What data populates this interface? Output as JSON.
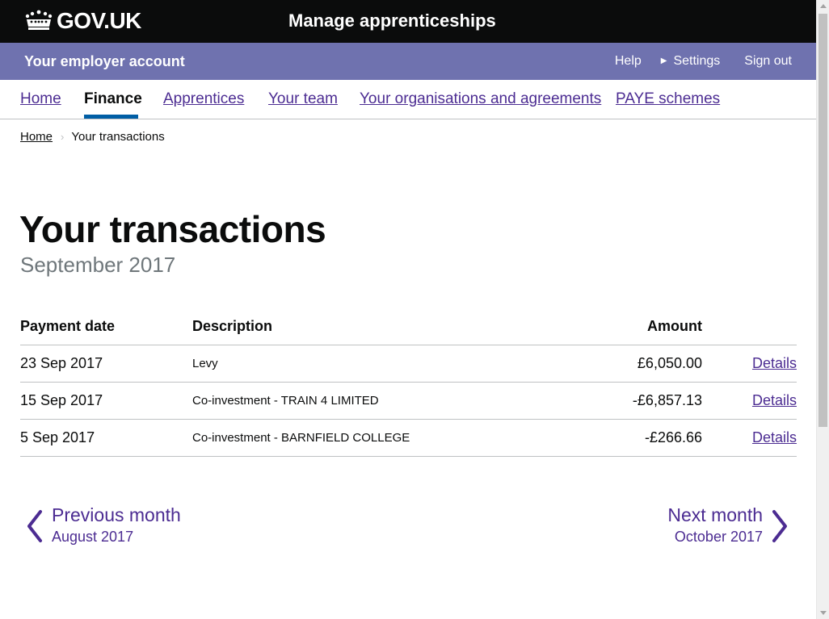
{
  "header": {
    "logo_text": "GOV.UK",
    "service_name": "Manage apprenticeships"
  },
  "account_bar": {
    "title": "Your employer account",
    "links": {
      "help": "Help",
      "settings": "Settings",
      "sign_out": "Sign out"
    }
  },
  "nav": {
    "items": [
      {
        "label": "Home",
        "active": false
      },
      {
        "label": "Finance",
        "active": true
      },
      {
        "label": "Apprentices",
        "active": false
      },
      {
        "label": "Your team",
        "active": false
      },
      {
        "label": "Your organisations and agreements",
        "active": false
      },
      {
        "label": "PAYE schemes",
        "active": false
      }
    ]
  },
  "breadcrumb": {
    "home": "Home",
    "current": "Your transactions"
  },
  "page": {
    "title": "Your transactions",
    "caption": "September 2017"
  },
  "table": {
    "headers": {
      "date": "Payment date",
      "description": "Description",
      "amount": "Amount"
    },
    "rows": [
      {
        "date": "23 Sep 2017",
        "description": "Levy",
        "amount": "£6,050.00",
        "link": "Details"
      },
      {
        "date": "15 Sep 2017",
        "description": "Co-investment - TRAIN 4 LIMITED",
        "amount": "-£6,857.13",
        "link": "Details"
      },
      {
        "date": "5 Sep 2017",
        "description": "Co-investment - BARNFIELD COLLEGE",
        "amount": "-£266.66",
        "link": "Details"
      }
    ]
  },
  "pagination": {
    "prev": {
      "label": "Previous month",
      "sub": "August 2017"
    },
    "next": {
      "label": "Next month",
      "sub": "October 2017"
    }
  },
  "colors": {
    "header_bg": "#0b0c0c",
    "account_bar_bg": "#6f72af",
    "link": "#4c2c92",
    "active_underline": "#005ea5"
  }
}
